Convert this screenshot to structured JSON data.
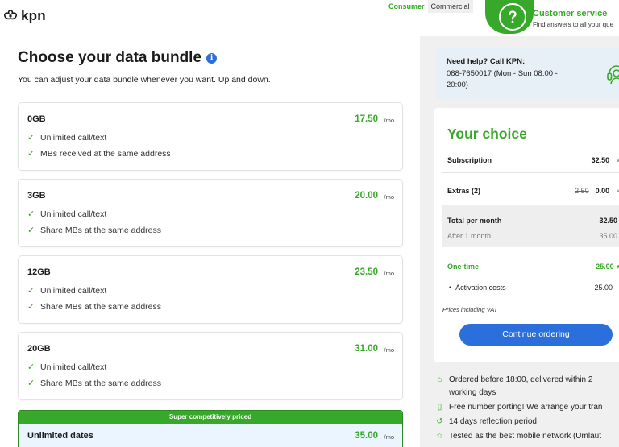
{
  "header": {
    "logo_text": "kpn",
    "segments": [
      "Consumer",
      "Commercial"
    ],
    "customer_service": {
      "title": "Customer service",
      "subtitle": "Find answers to all your que"
    }
  },
  "main": {
    "title": "Choose your data bundle",
    "subtitle": "You can adjust your data bundle whenever you want. Up and down.",
    "bundles": [
      {
        "name": "0GB",
        "price": "17.50",
        "unit": "/mo",
        "features": [
          "Unlimited call/text",
          "MBs received at the same address"
        ]
      },
      {
        "name": "3GB",
        "price": "20.00",
        "unit": "/mo",
        "features": [
          "Unlimited call/text",
          "Share MBs at the same address"
        ]
      },
      {
        "name": "12GB",
        "price": "23.50",
        "unit": "/mo",
        "features": [
          "Unlimited call/text",
          "Share MBs at the same address"
        ]
      },
      {
        "name": "20GB",
        "price": "31.00",
        "unit": "/mo",
        "features": [
          "Unlimited call/text",
          "Share MBs at the same address"
        ]
      }
    ],
    "featured": {
      "banner": "Super competitively priced",
      "name": "Unlimited dates",
      "price": "35.00",
      "unit": "/mo"
    }
  },
  "sidebar": {
    "help": {
      "title": "Need help? Call KPN:",
      "text": "088-7650017 (Mon - Sun 08:00 - 20:00)"
    },
    "choice": {
      "title": "Your choice",
      "subscription_label": "Subscription",
      "subscription_value": "32.50",
      "extras_label": "Extras (2)",
      "extras_old": "2.50",
      "extras_value": "0.00",
      "total_label": "Total per month",
      "total_value": "32.50",
      "after_label": "After 1 month",
      "after_value": "35.00",
      "onetime_label": "One-time",
      "onetime_value": "25.00",
      "activation_label": "Activation costs",
      "activation_value": "25.00",
      "vat_note": "Prices including VAT",
      "cta_label": "Continue ordering"
    },
    "usps": [
      {
        "icon": "home-icon",
        "text": "Ordered before 18:00, delivered within 2"
      },
      {
        "icon": "",
        "text": "working days"
      },
      {
        "icon": "phone-icon",
        "text": "Free number porting! We arrange your tran"
      },
      {
        "icon": "return-icon",
        "text": "14 days reflection period"
      },
      {
        "icon": "star-icon",
        "text": "Tested as the best mobile network (Umlaut"
      }
    ]
  },
  "colors": {
    "brand_green": "#37a829",
    "cta_blue": "#2a6fdb",
    "help_bg": "#e8f0f7"
  }
}
